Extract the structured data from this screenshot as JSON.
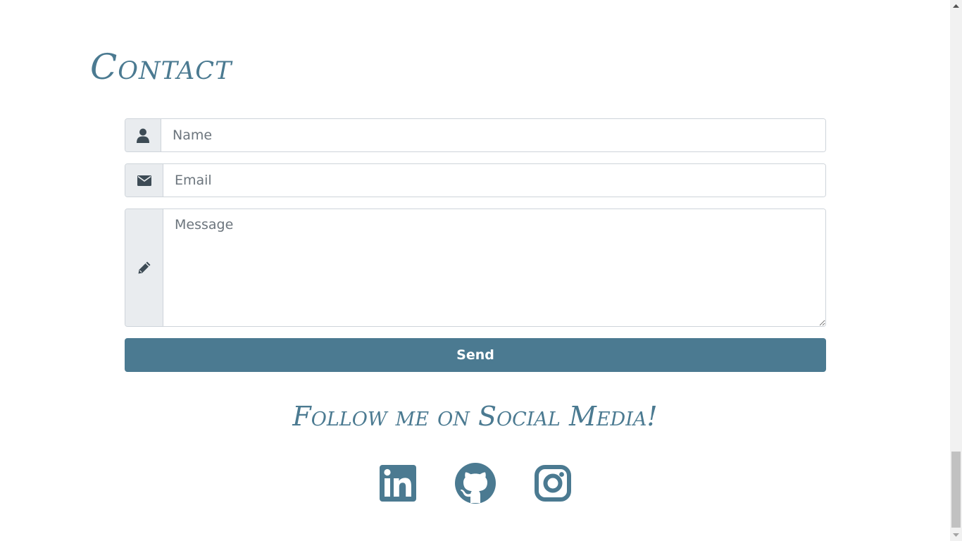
{
  "contact": {
    "heading": "Contact",
    "name_placeholder": "Name",
    "email_placeholder": "Email",
    "message_placeholder": "Message",
    "send_label": "Send"
  },
  "social": {
    "heading": "Follow me on Social Media!",
    "links": [
      {
        "icon": "linkedin-icon"
      },
      {
        "icon": "github-icon"
      },
      {
        "icon": "instagram-icon"
      }
    ]
  },
  "colors": {
    "accent": "#4b7a91",
    "addon_bg": "#e9ecef",
    "addon_icon": "#3d4b55",
    "border": "#ced4da"
  }
}
